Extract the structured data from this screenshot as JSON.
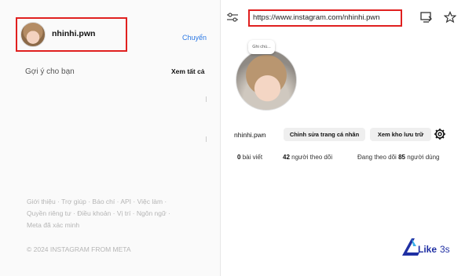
{
  "left_panel": {
    "username": "nhinhi.pwn",
    "switch_label": "Chuyển",
    "suggestions_title": "Gợi ý cho bạn",
    "see_all": "Xem tất cả",
    "footer_lines": [
      "Giới thiệu · Trợ giúp · Báo chí · API · Việc làm ·",
      "Quyền riêng tư · Điều khoản · Vị trí · Ngôn ngữ ·",
      "Meta đã xác minh"
    ],
    "copyright": "© 2024 INSTAGRAM FROM META"
  },
  "browser": {
    "url": "https://www.instagram.com/nhinhi.pwn",
    "icons": [
      "tune-icon",
      "install-icon",
      "star-icon"
    ]
  },
  "profile": {
    "note": "Ghi chú...",
    "username": "nhinhi.pwn",
    "edit_button": "Chỉnh sửa trang cá nhân",
    "archive_button": "Xem kho lưu trữ",
    "stats": {
      "posts_count": "0",
      "posts_label": "bài viết",
      "followers_count": "42",
      "followers_label": "người theo dõi",
      "following_prefix": "Đang theo dõi",
      "following_count": "85",
      "following_label": "người dùng"
    }
  },
  "watermark": {
    "text": "Like 3s"
  },
  "colors": {
    "highlight_border": "#e0201f",
    "link_blue": "#2b78e4",
    "logo_blue": "#1f2fa3"
  }
}
